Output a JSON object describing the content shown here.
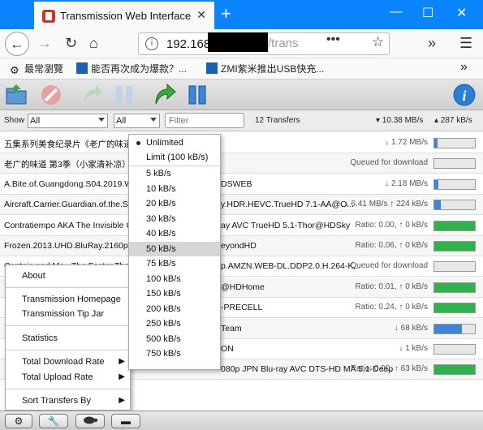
{
  "browser": {
    "tab_title": "Transmission Web Interface",
    "url_visible": "192.168.",
    "url_tail": "/trans",
    "bookmarks": [
      "最常瀏覽",
      "能否再次成为爆款？...",
      "ZMI紫米推出USB快充..."
    ]
  },
  "filter": {
    "show_label": "Show",
    "show_value": "All",
    "tracker_value": "All",
    "placeholder": "Filter",
    "count": "12 Transfers",
    "down_rate": "▾ 10.38 MB/s",
    "up_rate": "▴ 287 kB/s"
  },
  "torrents": [
    {
      "name": "五集系列美食纪录片《老广的味道》",
      "status": "↓ 1.72 MB/s",
      "progress": 0.08,
      "color": "#3d85d8"
    },
    {
      "name": "老广的味道 第3季（小家清补凉）",
      "status": "Queued for download",
      "progress": 0,
      "color": "#aaaaaa"
    },
    {
      "name": "A.Bite.of.Guangdong.S04.2019.WE",
      "name_tail": "DSWEB",
      "status": "↓ 2.18 MB/s",
      "progress": 0.1,
      "color": "#3d85d8"
    },
    {
      "name": "Aircraft.Carrier.Guardian.of.the.Sea",
      "name_tail": "y.HDR.HEVC.TrueHD 7.1-AA@O...",
      "status": "↓ 6.41 MB/s ↑ 224 kB/s",
      "progress": 0.15,
      "color": "#3d85d8"
    },
    {
      "name": "Contratiempo AKA The Invisible Gu",
      "name_tail": "ay AVC TrueHD 5.1-Thor@HDSky",
      "status": "Ratio: 0.00, ↑ 0 kB/s",
      "progress": 1,
      "color": "#2eb34a"
    },
    {
      "name": "Frozen.2013.UHD.BluRay.2160p.HE",
      "name_tail": "eyondHD",
      "status": "Ratio: 0.06, ↑ 0 kB/s",
      "progress": 1,
      "color": "#2eb34a"
    },
    {
      "name": "Captain.and.Ma...The.Faster.That.Sky",
      "name_tail": "p.AMZN.WEB-DL.DDP2.0.H.264-K...",
      "status": "Queued for download",
      "progress": 0,
      "color": "#aaaaaa"
    },
    {
      "name": "",
      "name_tail": "@HDHome",
      "status": "Ratio: 0.01, ↑ 0 kB/s",
      "progress": 1,
      "color": "#2eb34a"
    },
    {
      "name": "",
      "name_tail": "-PRECELL",
      "status": "Ratio: 0.24, ↑ 0 kB/s",
      "progress": 1,
      "color": "#2eb34a"
    },
    {
      "name": "",
      "name_tail": "Team",
      "status": "↓ 68 kB/s",
      "progress": 0.68,
      "color": "#3d85d8"
    },
    {
      "name": "",
      "name_tail": "ON",
      "status": "↓ 1 kB/s",
      "progress": 0,
      "color": "#aaaaaa"
    },
    {
      "name": "",
      "name_tail": "080p JPN Blu-ray AVC DTS-HD MA 5.1-Deep",
      "status": "Ratio: 0.00, ↑ 63 kB/s",
      "progress": 1,
      "color": "#2eb34a"
    }
  ],
  "context_menu": {
    "about": "About",
    "homepage": "Transmission Homepage",
    "tipjar": "Transmission Tip Jar",
    "statistics": "Statistics",
    "total_download": "Total Download Rate",
    "total_upload": "Total Upload Rate",
    "sort_by": "Sort Transfers By"
  },
  "rate_dropdown": {
    "items": [
      "Unlimited",
      "Limit (100 kB/s)",
      "5 kB/s",
      "10 kB/s",
      "20 kB/s",
      "30 kB/s",
      "40 kB/s",
      "50 kB/s",
      "75 kB/s",
      "100 kB/s",
      "150 kB/s",
      "200 kB/s",
      "250 kB/s",
      "500 kB/s",
      "750 kB/s"
    ],
    "selected_index": 7
  }
}
